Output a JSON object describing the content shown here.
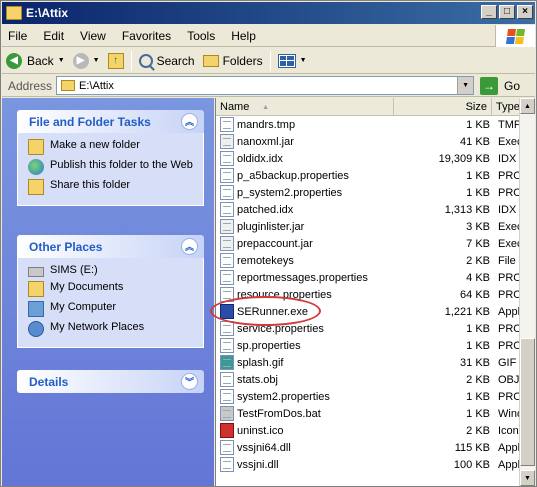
{
  "window": {
    "title": "E:\\Attix"
  },
  "menu": [
    "File",
    "Edit",
    "View",
    "Favorites",
    "Tools",
    "Help"
  ],
  "toolbar": {
    "back_label": "Back",
    "search_label": "Search",
    "folders_label": "Folders"
  },
  "address": {
    "label": "Address",
    "value": "E:\\Attix",
    "go_label": "Go"
  },
  "tasks_panel": {
    "title": "File and Folder Tasks",
    "items": [
      "Make a new folder",
      "Publish this folder to the Web",
      "Share this folder"
    ]
  },
  "places_panel": {
    "title": "Other Places",
    "items": [
      "SIMS (E:)",
      "My Documents",
      "My Computer",
      "My Network Places"
    ]
  },
  "details_panel": {
    "title": "Details"
  },
  "columns": {
    "name": "Name",
    "size": "Size",
    "type": "Type"
  },
  "files": [
    {
      "name": "mandrs.tmp",
      "size": "1 KB",
      "type": "TMP",
      "icon": "file"
    },
    {
      "name": "nanoxml.jar",
      "size": "41 KB",
      "type": "Exec",
      "icon": "jar"
    },
    {
      "name": "oldidx.idx",
      "size": "19,309 KB",
      "type": "IDX I",
      "icon": "file"
    },
    {
      "name": "p_a5backup.properties",
      "size": "1 KB",
      "type": "PRO",
      "icon": "file"
    },
    {
      "name": "p_system2.properties",
      "size": "1 KB",
      "type": "PRO",
      "icon": "file"
    },
    {
      "name": "patched.idx",
      "size": "1,313 KB",
      "type": "IDX I",
      "icon": "file"
    },
    {
      "name": "pluginlister.jar",
      "size": "3 KB",
      "type": "Exec",
      "icon": "jar"
    },
    {
      "name": "prepaccount.jar",
      "size": "7 KB",
      "type": "Exec",
      "icon": "jar"
    },
    {
      "name": "remotekeys",
      "size": "2 KB",
      "type": "File",
      "icon": "file"
    },
    {
      "name": "reportmessages.properties",
      "size": "4 KB",
      "type": "PRO",
      "icon": "file"
    },
    {
      "name": "resource.properties",
      "size": "64 KB",
      "type": "PRO",
      "icon": "file"
    },
    {
      "name": "SERunner.exe",
      "size": "1,221 KB",
      "type": "Appl",
      "icon": "exe"
    },
    {
      "name": "service.properties",
      "size": "1 KB",
      "type": "PRO",
      "icon": "file"
    },
    {
      "name": "sp.properties",
      "size": "1 KB",
      "type": "PRO",
      "icon": "file"
    },
    {
      "name": "splash.gif",
      "size": "31 KB",
      "type": "GIF I",
      "icon": "img"
    },
    {
      "name": "stats.obj",
      "size": "2 KB",
      "type": "OBJ",
      "icon": "file"
    },
    {
      "name": "system2.properties",
      "size": "1 KB",
      "type": "PRO",
      "icon": "file"
    },
    {
      "name": "TestFromDos.bat",
      "size": "1 KB",
      "type": "Wind",
      "icon": "bat"
    },
    {
      "name": "uninst.ico",
      "size": "2 KB",
      "type": "Icon",
      "icon": "ico"
    },
    {
      "name": "vssjni64.dll",
      "size": "115 KB",
      "type": "Appl",
      "icon": "file"
    },
    {
      "name": "vssjni.dll",
      "size": "100 KB",
      "type": "Appl",
      "icon": "file"
    }
  ]
}
